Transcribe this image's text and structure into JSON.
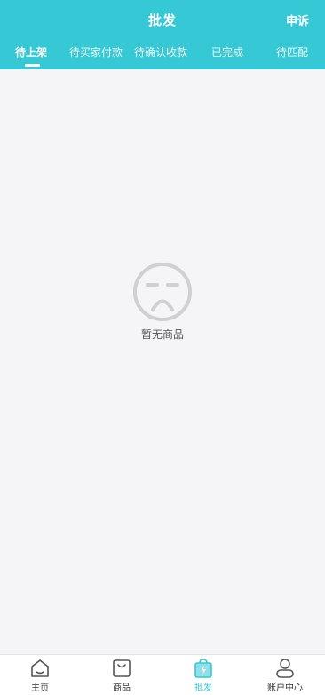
{
  "header": {
    "title": "批发",
    "appeal_label": "申诉"
  },
  "tabs": [
    {
      "label": "待上架",
      "active": true
    },
    {
      "label": "待买家付款",
      "active": false
    },
    {
      "label": "待确认收款",
      "active": false
    },
    {
      "label": "已完成",
      "active": false
    },
    {
      "label": "待匹配",
      "active": false
    }
  ],
  "empty_state": {
    "icon": "sad-face-icon",
    "message": "暂无商品"
  },
  "bottom_nav": [
    {
      "label": "主页",
      "icon": "home-icon",
      "active": false
    },
    {
      "label": "商品",
      "icon": "bag-icon",
      "active": false
    },
    {
      "label": "批发",
      "icon": "wholesale-bag-icon",
      "active": true
    },
    {
      "label": "账户中心",
      "icon": "user-icon",
      "active": false
    }
  ],
  "colors": {
    "accent": "#36c8d4",
    "background": "#f5f4f7",
    "icon_gray": "#d0d0d0"
  }
}
